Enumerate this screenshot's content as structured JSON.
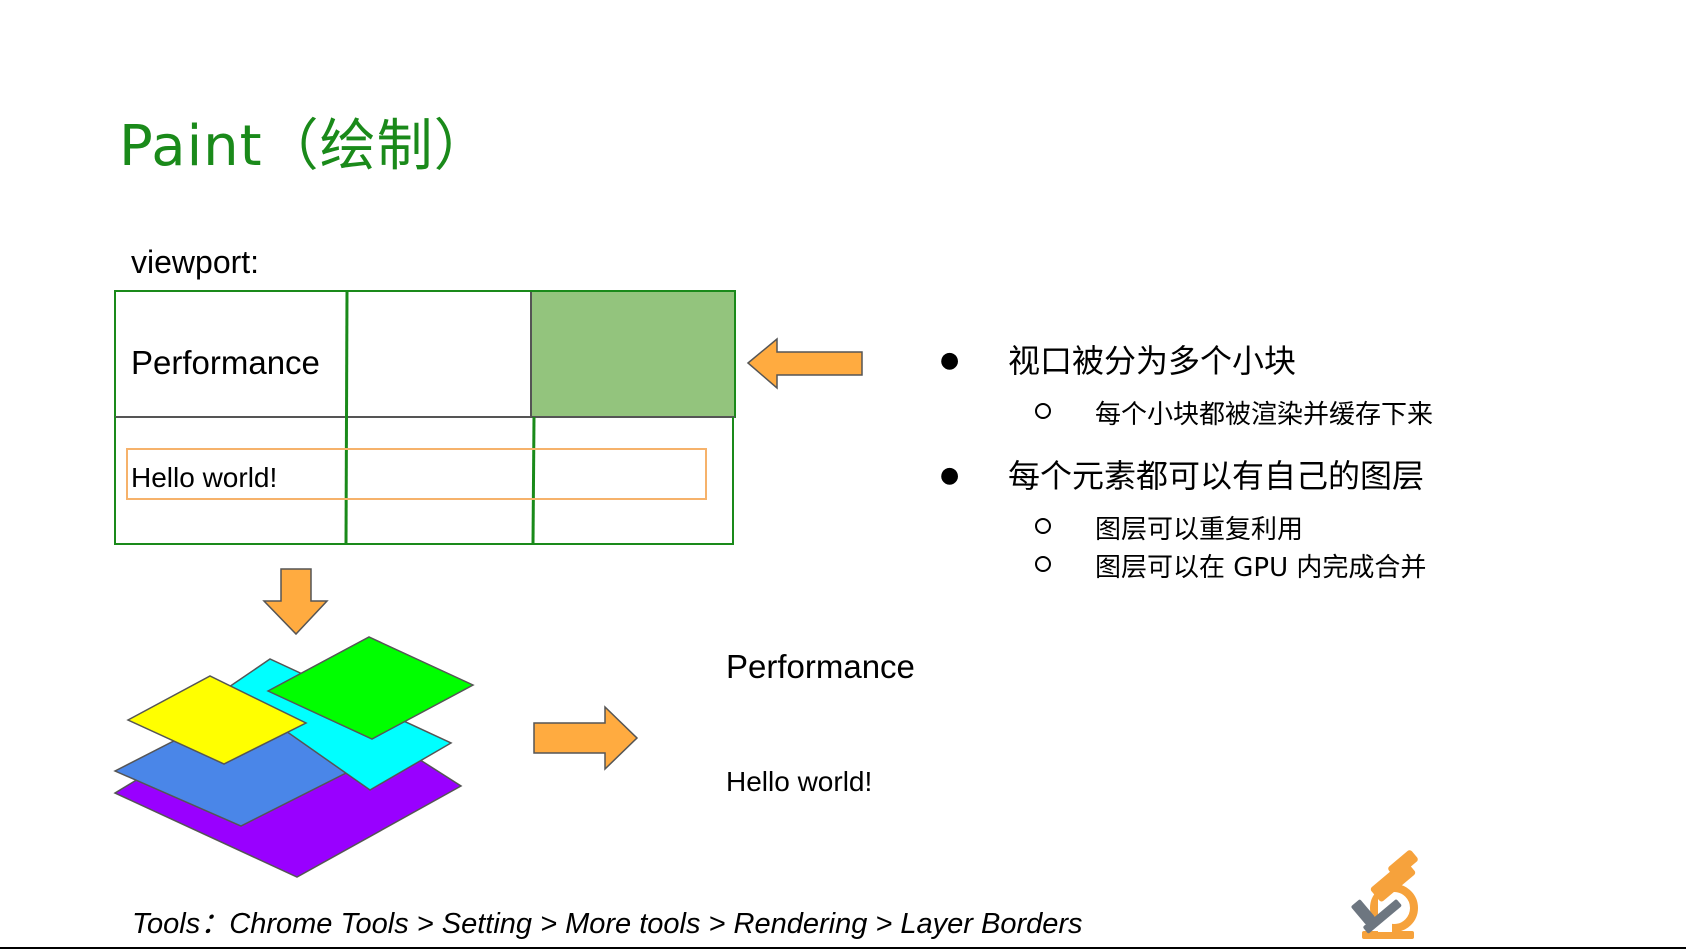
{
  "slide": {
    "title": "Paint（绘制）",
    "viewport_label": "viewport:",
    "tools_line": "Tools：Chrome Tools > Setting > More tools > Rendering > Layer Borders"
  },
  "viewport_grid": {
    "cell_text_1": "Performance",
    "cell_text_2": "Hello world!"
  },
  "result": {
    "text_1": "Performance",
    "text_2": "Hello world!"
  },
  "bullets": [
    {
      "text": "视口被分为多个小块",
      "sub": [
        "每个小块都被渲染并缓存下来"
      ]
    },
    {
      "text": "每个元素都可以有自己的图层",
      "sub": [
        "图层可以重复利用",
        "图层可以在 GPU 内完成合并"
      ]
    }
  ],
  "colors": {
    "title_green": "#1a8a1a",
    "grid_green": "#1a8a1a",
    "tile_fill": "#93c47d",
    "arrow_orange": "#ffab40",
    "layer_yellow": "#ffff00",
    "layer_green": "#00ff00",
    "layer_cyan": "#00ffff",
    "layer_blue": "#4a86e8",
    "layer_purple": "#9900ff",
    "hello_box": "#f6b26b"
  },
  "icons": [
    "microscope-icon"
  ]
}
